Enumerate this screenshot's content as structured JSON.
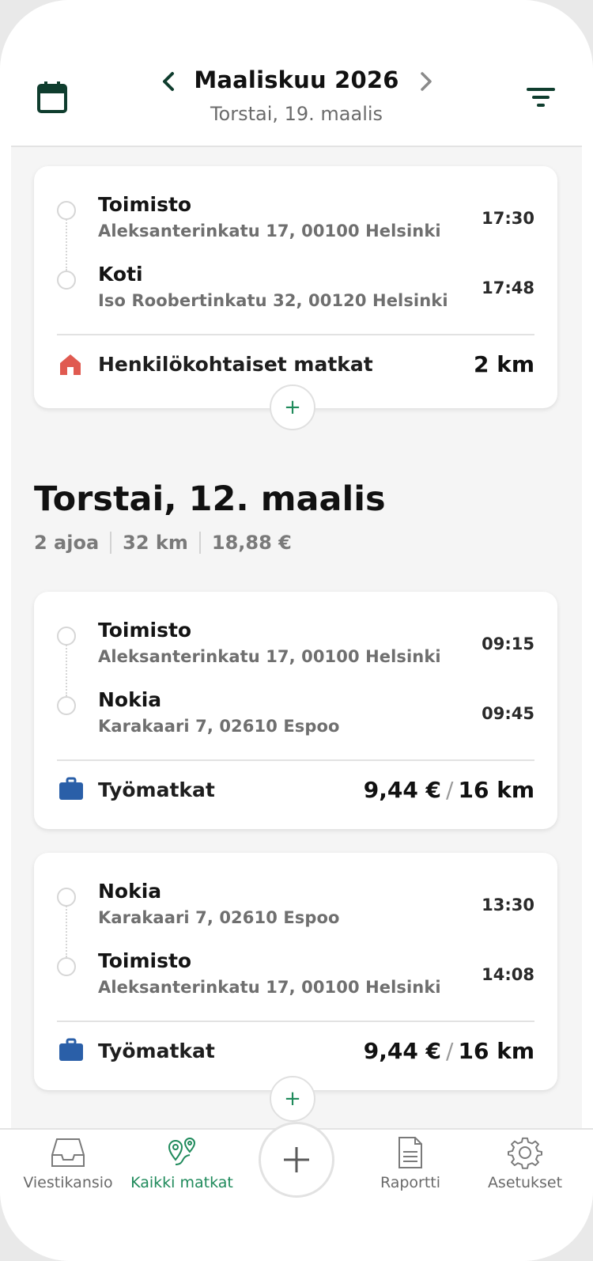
{
  "header": {
    "month_title": "Maaliskuu 2026",
    "selected_date": "Torstai, 19. maalis",
    "icons": {
      "calendar": "calendar-icon",
      "prev": "chevron-left-icon",
      "next": "chevron-right-icon",
      "filter": "filter-icon"
    }
  },
  "trips": [
    {
      "from": {
        "name": "Toimisto",
        "address": "Aleksanterinkatu 17, 00100 Helsinki",
        "time": "17:30"
      },
      "to": {
        "name": "Koti",
        "address": "Iso Roobertinkatu 32, 00120 Helsinki",
        "time": "17:48"
      },
      "category": "Henkilökohtaiset matkat",
      "distance": "2 km"
    }
  ],
  "day": {
    "title": "Torstai, 12. maalis",
    "stats": [
      "2 ajoa",
      "32 km",
      "18,88 €"
    ],
    "trips": [
      {
        "from": {
          "name": "Toimisto",
          "address": "Aleksanterinkatu 17, 00100 Helsinki",
          "time": "09:15"
        },
        "to": {
          "name": "Nokia",
          "address": "Karakaari 7, 02610 Espoo",
          "time": "09:45"
        },
        "category": "Työmatkat",
        "amount": "9,44 €",
        "separator": "/",
        "distance": "16 km"
      },
      {
        "from": {
          "name": "Nokia",
          "address": "Karakaari 7, 02610 Espoo",
          "time": "13:30"
        },
        "to": {
          "name": "Toimisto",
          "address": "Aleksanterinkatu 17, 00100 Helsinki",
          "time": "14:08"
        },
        "category": "Työmatkat",
        "amount": "9,44 €",
        "separator": "/",
        "distance": "16 km"
      }
    ]
  },
  "add_symbol": "+",
  "nav": {
    "items": [
      {
        "label": "Viestikansio",
        "icon": "inbox-icon"
      },
      {
        "label": "Kaikki matkat",
        "icon": "route-pins-icon"
      },
      {
        "label": "Raportti",
        "icon": "document-icon"
      },
      {
        "label": "Asetukset",
        "icon": "gear-icon"
      }
    ],
    "active": "Kaikki matkat"
  },
  "colors": {
    "accent": "#1f8a5b",
    "header_icon": "#0f3d2e",
    "personal": "#e05a50",
    "work": "#2a5fa8"
  }
}
